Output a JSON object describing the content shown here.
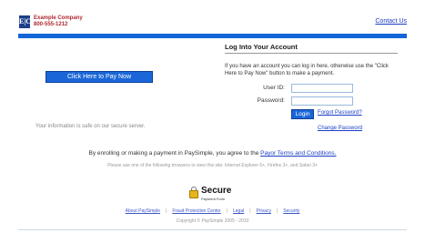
{
  "header": {
    "logo_text": "E|C",
    "company_name": "Example Company",
    "company_phone": "800-555-1212",
    "contact_link": "Contact Us"
  },
  "left": {
    "pay_button": "Click Here to Pay Now",
    "safe_text": "Your information is safe on our secure server."
  },
  "login": {
    "title": "Log Into Your Account",
    "intro": "If you have an account you can log in here, otherwise use the \"Click Here to Pay Now\" button to make a payment.",
    "user_id_label": "User ID:",
    "password_label": "Password:",
    "user_id_value": "",
    "password_value": "",
    "login_button": "Login",
    "forgot_link": "Forgot Password?",
    "change_link": "Change Password"
  },
  "agreement": {
    "prefix": "By enrolling or making a payment in PaySimple, you agree to the ",
    "link": "Payor Terms and Conditions."
  },
  "browsers_text": "Please use one of the following browsers to view this site: Internet Explorer 6+, Firefox 3+, and Safari 3+",
  "secure_badge": {
    "big": "Secure",
    "small": "Payment Form"
  },
  "footer": {
    "links": [
      "About PaySimple",
      "Fraud Protection Center",
      "Legal",
      "Privacy",
      "Security"
    ],
    "copyright": "Copyright © PaySimple 2005 - 2010"
  },
  "colors": {
    "accent_blue": "#1466d8",
    "company_red": "#b0282e",
    "link_blue": "#1a3fc4"
  }
}
